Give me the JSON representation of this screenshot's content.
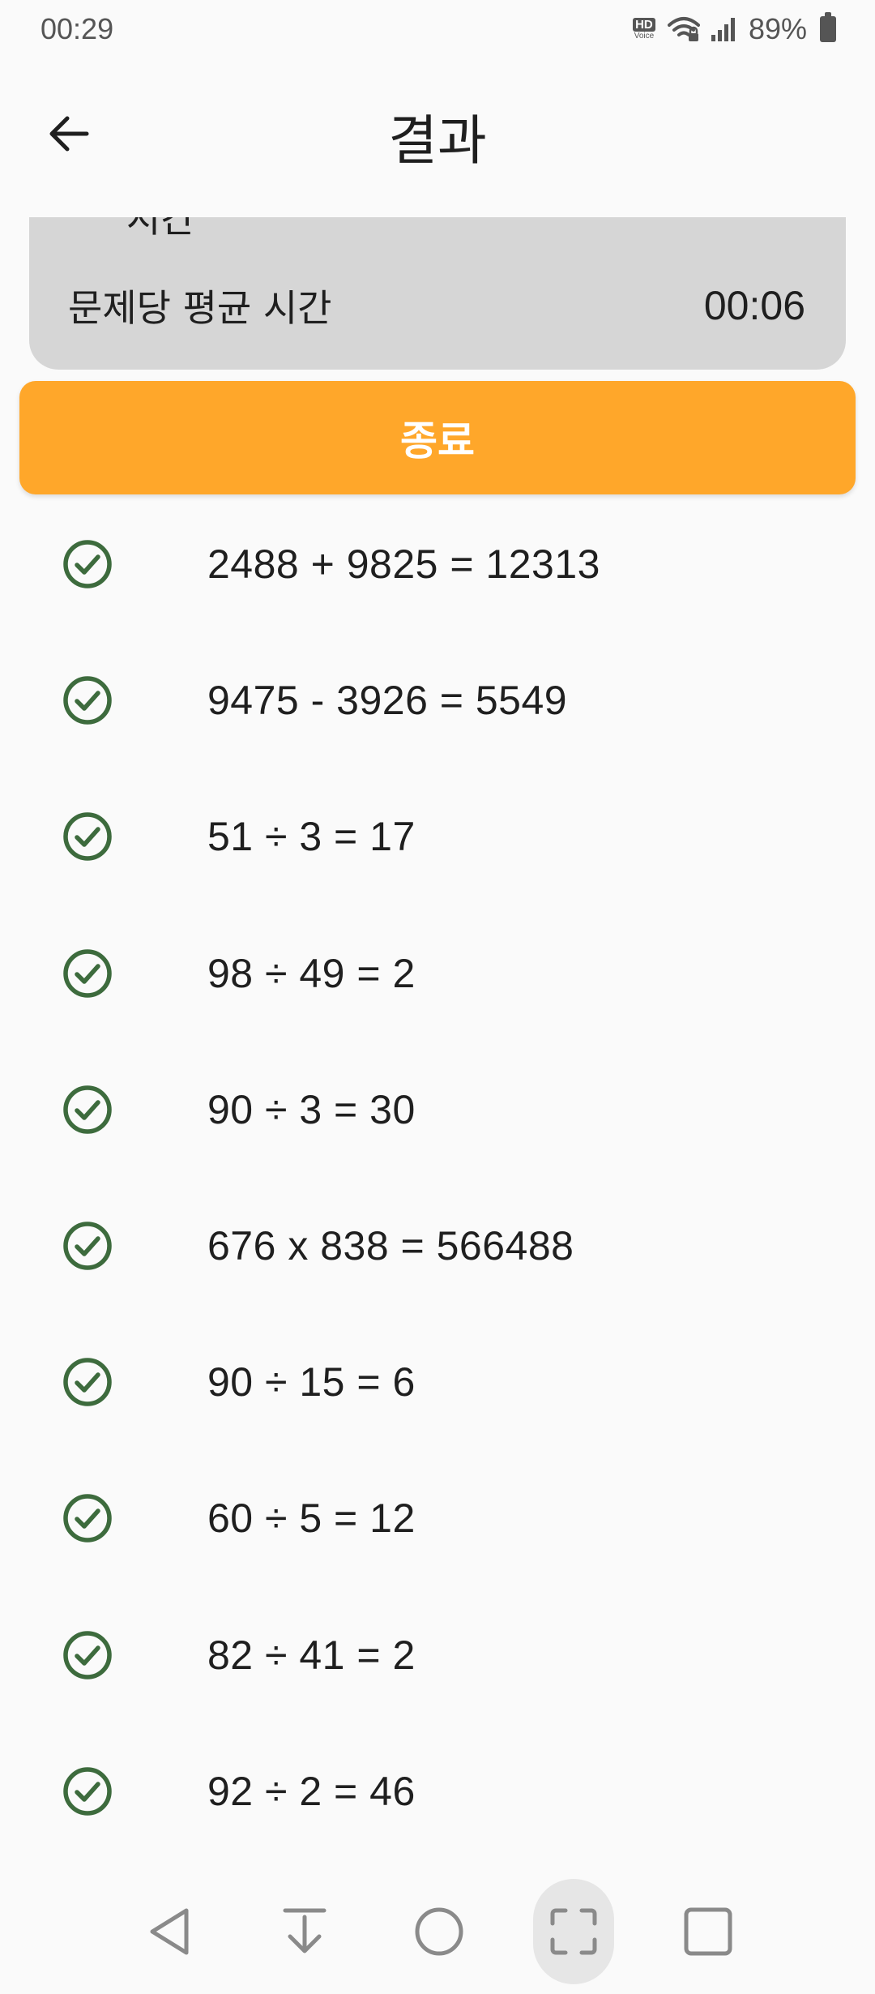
{
  "status_bar": {
    "time": "00:29",
    "hd_label": "HD",
    "voice_label": "Voice",
    "battery": "89%"
  },
  "app_bar": {
    "title": "결과"
  },
  "stats": {
    "cutoff_label": "시간",
    "avg_label": "문제당 평균 시간",
    "avg_value": "00:06"
  },
  "end_button": {
    "label": "종료"
  },
  "problems": [
    "2488 + 9825 = 12313",
    "9475 - 3926 = 5549",
    "51 ÷ 3 = 17",
    "98 ÷ 49 = 2",
    "90 ÷ 3 = 30",
    "676 x 838 = 566488",
    "90 ÷ 15 = 6",
    "60 ÷ 5 = 12",
    "82 ÷ 41 = 2",
    "92 ÷ 2 = 46"
  ],
  "colors": {
    "accent": "#ffa72a",
    "check": "#3d6b3d",
    "card": "#d6d6d6"
  }
}
